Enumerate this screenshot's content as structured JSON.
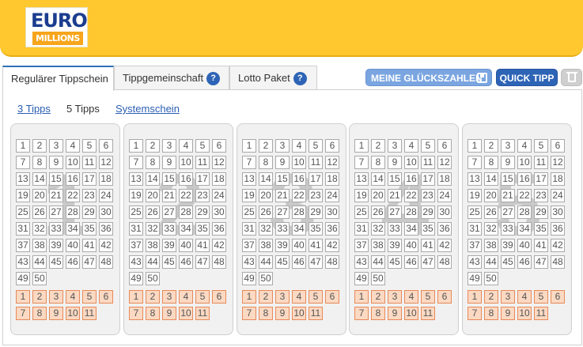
{
  "header": {
    "logo_line1": "EURO",
    "logo_line2": "MILLIONS"
  },
  "tabs": [
    {
      "label": "Regulärer Tippschein",
      "help": false
    },
    {
      "label": "Tippgemeinschaft",
      "help": true
    },
    {
      "label": "Lotto Paket",
      "help": true
    }
  ],
  "help_icon": "?",
  "toolbar": {
    "favorites_label": "MEINE GLÜCKSZAHLEN",
    "favorites_icon": "save-icon",
    "quick_label": "QUICK TIPP",
    "delete_icon": "trash-icon"
  },
  "subtabs": [
    {
      "label": "3 Tipps",
      "active": false
    },
    {
      "label": "5 Tipps",
      "active": true
    },
    {
      "label": "Systemschein",
      "active": false
    }
  ],
  "tickets": [
    {
      "index": "1"
    },
    {
      "index": "2"
    },
    {
      "index": "3"
    },
    {
      "index": "4"
    },
    {
      "index": "5"
    }
  ],
  "numbers": [
    "1",
    "2",
    "3",
    "4",
    "5",
    "6",
    "7",
    "8",
    "9",
    "10",
    "11",
    "12",
    "13",
    "14",
    "15",
    "16",
    "17",
    "18",
    "19",
    "20",
    "21",
    "22",
    "23",
    "24",
    "25",
    "26",
    "27",
    "28",
    "29",
    "30",
    "31",
    "32",
    "33",
    "34",
    "35",
    "36",
    "37",
    "38",
    "39",
    "40",
    "41",
    "42",
    "43",
    "44",
    "45",
    "46",
    "47",
    "48",
    "49",
    "50"
  ],
  "stars": [
    "1",
    "2",
    "3",
    "4",
    "5",
    "6",
    "7",
    "8",
    "9",
    "10",
    "11"
  ],
  "colors": {
    "header": "#ffc82e",
    "primary_button": "#2e64b6",
    "star_fill": "#fbd9c2",
    "link": "#2b5fb3"
  }
}
